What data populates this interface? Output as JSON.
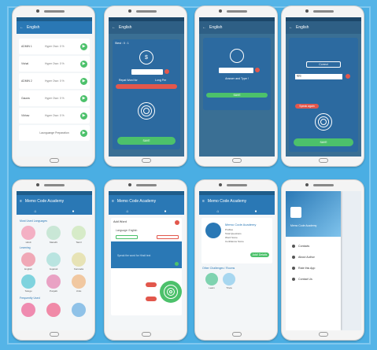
{
  "colors": {
    "background": "#55b4e7",
    "appbar": "#2a78b5",
    "accent_green": "#4cc16b",
    "accent_red": "#e2574c"
  },
  "screen1": {
    "back_icon": "arrow-left-icon",
    "title": "English",
    "rows": [
      {
        "name": "ADMIN 1",
        "info": "Hyper Own: 0 %"
      },
      {
        "name": "Vishal",
        "info": "Hyper Own: 0 %"
      },
      {
        "name": "ADMIN 2",
        "info": "Hyper Own: 0 %"
      },
      {
        "name": "Gaurav",
        "info": "Hyper Own: 0 %"
      },
      {
        "name": "Vibhav",
        "info": "Hyper Own: 0 %"
      }
    ],
    "footer": "Launguange Preparation"
  },
  "screen2": {
    "title": "English",
    "dialog_head": "Stest : 0 : 1",
    "left_btn": "Repat Word for",
    "right_btn": "Long Per",
    "submit": "SAVE"
  },
  "screen3": {
    "title": "English",
    "label": "Answer and Type !",
    "submit": "SAVE"
  },
  "screen4": {
    "title": "English",
    "box_label": "Correct",
    "answer": "गाय",
    "note_btn": "Speak again",
    "submit": "SAVE"
  },
  "screen5": {
    "title": "Memo Code Academy",
    "sections": [
      "Most Used Languages",
      "Learning",
      "Frequently Used"
    ],
    "items": [
      "Hindi",
      "Marathi",
      "Tamil",
      "English",
      "Gujarati",
      "Kannada",
      "Telugu",
      "Punjabi",
      "Urdu"
    ]
  },
  "screen6": {
    "title": "Memo Code Academy",
    "panel_title": "Add Word",
    "lang_label": "Language: English",
    "hint": "Speak the word for Hindi text"
  },
  "screen7": {
    "title": "Memo Code Academy",
    "profile_name": "Memo Code Academy",
    "lines": [
      "Profiles",
      "Total Questions",
      "Word Score",
      "Confidence Score"
    ],
    "button": "Add/ Details",
    "section": "Other Challenges / Rooms",
    "items": [
      "Learn",
      "Trivia"
    ]
  },
  "screen8": {
    "header": "Memo Code Academy",
    "menu": [
      "Contacts",
      "About Author",
      "Rate this App",
      "Contact Us"
    ]
  }
}
